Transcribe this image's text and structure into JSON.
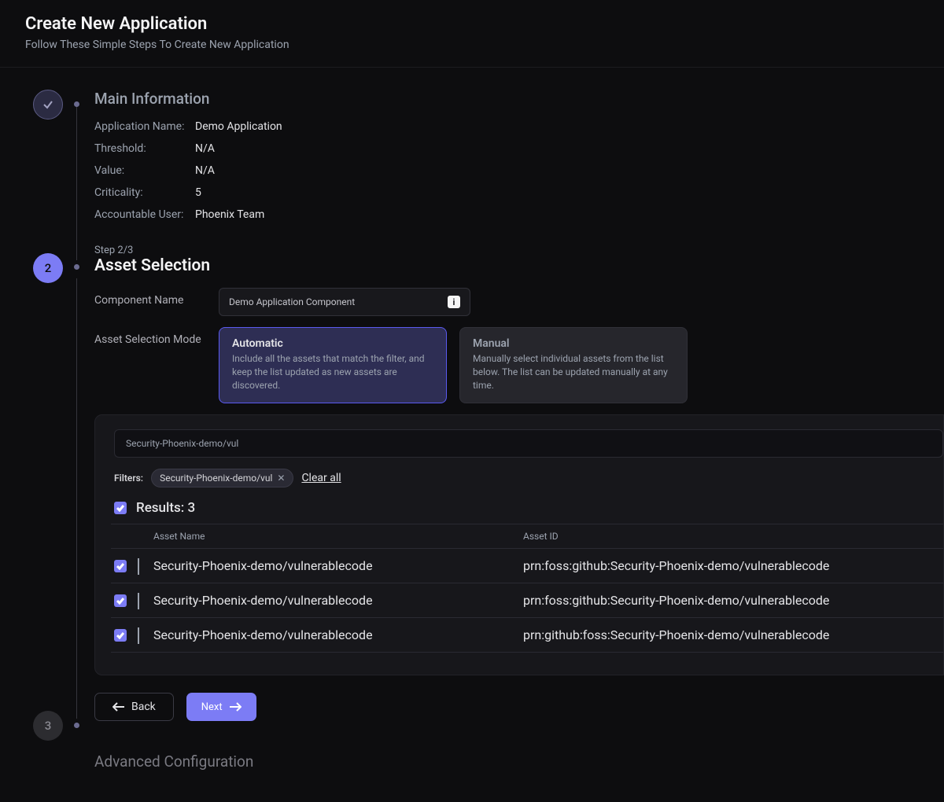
{
  "header": {
    "title": "Create New Application",
    "subtitle": "Follow These Simple Steps To Create New Application"
  },
  "stepper": {
    "step2_number": "2",
    "step3_number": "3"
  },
  "main_info": {
    "title": "Main Information",
    "app_name_label": "Application Name:",
    "app_name_value": "Demo Application",
    "threshold_label": "Threshold:",
    "threshold_value": "N/A",
    "value_label": "Value:",
    "value_value": "N/A",
    "criticality_label": "Criticality:",
    "criticality_value": "5",
    "user_label": "Accountable User:",
    "user_value": "Phoenix Team"
  },
  "asset": {
    "step_label": "Step 2/3",
    "title": "Asset Selection",
    "component_label": "Component Name",
    "component_value": "Demo Application Component",
    "mode_label": "Asset Selection Mode",
    "auto_title": "Automatic",
    "auto_desc": "Include all the assets that match the filter, and keep the list updated as new assets are discovered.",
    "manual_title": "Manual",
    "manual_desc": "Manually select individual assets from the list below. The list can be updated manually at any time."
  },
  "results": {
    "search_value": "Security-Phoenix-demo/vul",
    "filters_label": "Filters:",
    "chip_text": "Security-Phoenix-demo/vul",
    "clear_all": "Clear all",
    "results_label": "Results: 3",
    "col_name": "Asset Name",
    "col_id": "Asset ID",
    "rows": [
      {
        "name": "Security-Phoenix-demo/vulnerablecode",
        "id": "prn:foss:github:Security-Phoenix-demo/vulnerablecode"
      },
      {
        "name": "Security-Phoenix-demo/vulnerablecode",
        "id": "prn:foss:github:Security-Phoenix-demo/vulnerablecode"
      },
      {
        "name": "Security-Phoenix-demo/vulnerablecode",
        "id": "prn:github:foss:Security-Phoenix-demo/vulnerablecode"
      }
    ]
  },
  "buttons": {
    "back": "Back",
    "next": "Next"
  },
  "section3": {
    "title": "Advanced Configuration"
  }
}
